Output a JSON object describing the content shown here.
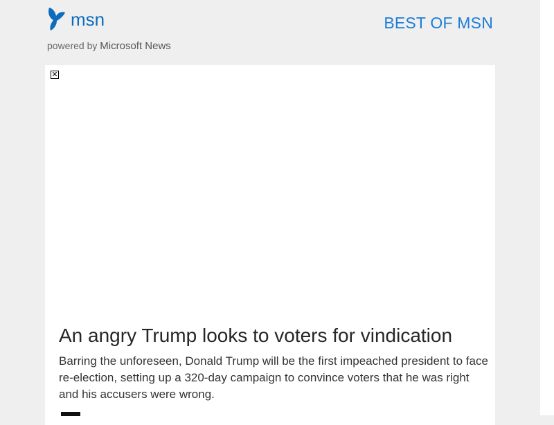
{
  "header": {
    "logo_text": "msn",
    "powered_by_prefix": "powered by",
    "powered_by_brand": "Microsoft News",
    "best_of_label": "BEST OF MSN"
  },
  "ad": {
    "close_glyph": "✕"
  },
  "article": {
    "headline": "An angry Trump looks to voters for vindication",
    "summary": "Barring the unforeseen, Donald Trump will be the first impeached president to face re-election, setting up a 320-day campaign to convince voters that he was right and his accusers were wrong."
  },
  "icons": {
    "logo": "msn-butterfly-icon",
    "ad_close": "close-icon"
  },
  "colors": {
    "brand_blue": "#0f6cbd",
    "link_blue": "#1e7dd6",
    "page_bg": "#efefef",
    "card_bg": "#ffffff"
  }
}
